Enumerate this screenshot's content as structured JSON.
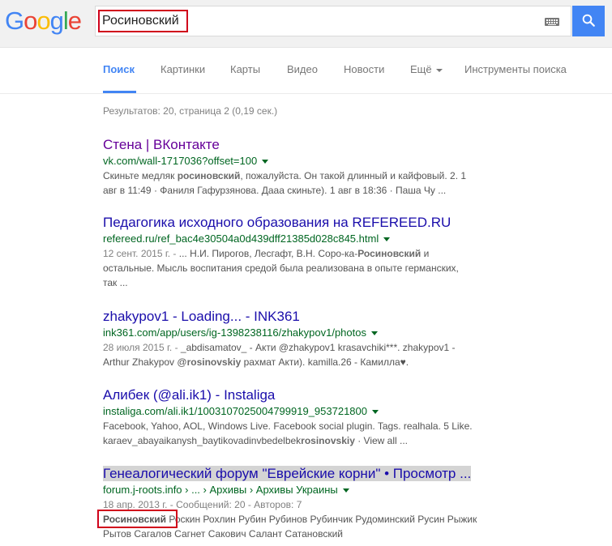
{
  "logo": {
    "text": "Google"
  },
  "search": {
    "query": "Росиновский",
    "keyboard_icon": "keyboard-icon",
    "button_icon": "search-icon"
  },
  "tabs": [
    {
      "label": "Поиск",
      "active": true
    },
    {
      "label": "Картинки"
    },
    {
      "label": "Карты"
    },
    {
      "label": "Видео"
    },
    {
      "label": "Новости"
    },
    {
      "label": "Ещё"
    },
    {
      "label": "Инструменты поиска"
    }
  ],
  "stats": "Результатов: 20, страница 2 (0,19 сек.)",
  "results": [
    {
      "title": "Стена | ВКонтакте",
      "url": "vk.com/wall-1717036?offset=100",
      "snippet_line1_a": "Скиньте медляк ",
      "snippet_line1_b": "росиновский",
      "snippet_line1_c": ", пожалуйста. Он такой длинный и кайфовый. 2. 1",
      "snippet_line2": "авг в 11:49 · Фаниля Гафурзянова. Дааа скиньте). 1 авг в 18:36 · Паша Чу ..."
    },
    {
      "title": "Педагогика исходного образования на REFEREED.RU",
      "url": "refereed.ru/ref_bac4e30504a0d439dff21385d028c845.html",
      "date": "12 сент. 2015 г. - ",
      "snippet_line1_a": "... Н.И. Пирогов, Лесгафт, В.Н. Соро-ка-",
      "snippet_line1_b": "Росиновский",
      "snippet_line1_c": " и",
      "snippet_line2": "остальные. Мысль воспитания средой была реализована в опыте германских,",
      "snippet_line3": "так ..."
    },
    {
      "title": "zhakypov1 - Loading... - INK361",
      "url": "ink361.com/app/users/ig-1398238116/zhakypov1/photos",
      "date": "28 июля 2015 г. - ",
      "snippet_line1_a": "_abdisamatov_ - Акти @zhakypov1 krasavchiki***. zhakypov1 -",
      "snippet_line2_a": "Arthur Zhakypov @",
      "snippet_line2_b": "rosinovskiy",
      "snippet_line2_c": " рахмат Акти). kamilla.26 - Камилла♥."
    },
    {
      "title": "Алибек (@ali.ik1) - Instaliga",
      "url": "instaliga.com/ali.ik1/1003107025004799919_953721800",
      "snippet_line1": "Facebook, Yahoo, AOL, Windows Live. Facebook social plugin. Tags. realhala. 5 Like.",
      "snippet_line2_a": "karaev_abayaikanysh_baytikovadinvbedelbek",
      "snippet_line2_b": "rosinovskiy",
      "snippet_line2_c": " · View all ..."
    },
    {
      "title": "Генеалогический форум \"Еврейские корни\" • Просмотр ...",
      "url": "forum.j-roots.info › ... › Архивы › Архивы Украины",
      "date": "18 апр. 2013 г. - ",
      "snippet_line1_a": "Сообщений: 20 - Авторов: 7",
      "snippet_line2_a": "Росиновский",
      "snippet_line2_b": " Роскин Рохлин Рубин Рубинов Рубинчик Рудоминский Русин Рыжик",
      "snippet_line3": "Рытов Сагалов Сагнет Сакович Салант Сатановский"
    }
  ],
  "colors": {
    "accent": "#4285f4",
    "title": "#1a0dab",
    "visited": "#660099",
    "url": "#006621",
    "highlight": "#d0021b"
  }
}
